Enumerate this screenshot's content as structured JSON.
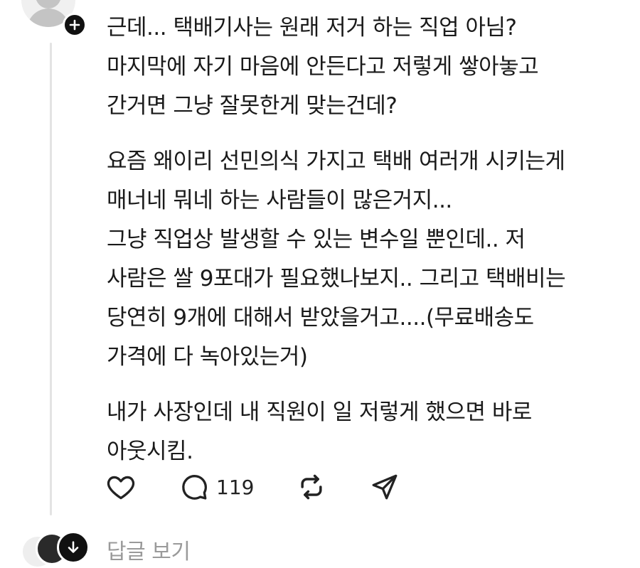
{
  "post": {
    "paragraphs": [
      {
        "lines": [
          "근데... 택배기사는 원래 저거 하는 직업 아님?",
          "마지막에 자기 마음에 안든다고 저렇게 쌓아놓고",
          "간거면 그냥 잘못한게 맞는건데?"
        ]
      },
      {
        "lines": [
          "요즘 왜이리 선민의식 가지고 택배 여러개 시키는게",
          "매너네 뭐네 하는 사람들이 많은거지...",
          "그냥 직업상 발생할 수 있는 변수일 뿐인데.. 저",
          "사람은 쌀 9포대가 필요했나보지.. 그리고 택배비는",
          "당연히 9개에 대해서 받았을거고....(무료배송도",
          "가격에 다 녹아있는거)"
        ]
      },
      {
        "lines": [
          "내가 사장인데 내 직원이 일 저렇게 했으면 바로",
          "아웃시킴."
        ]
      }
    ]
  },
  "actions": {
    "like_icon": "heart-icon",
    "reply_icon": "comment-bubble-icon",
    "reply_count": "119",
    "repost_icon": "repost-icon",
    "share_icon": "send-icon"
  },
  "replies": {
    "label": "답글 보기",
    "expand_icon": "arrow-down-icon"
  },
  "colors": {
    "text": "#1a1a1a",
    "muted": "#9a9a9a",
    "badge": "#111111",
    "thread_line": "#e3e3e3"
  }
}
